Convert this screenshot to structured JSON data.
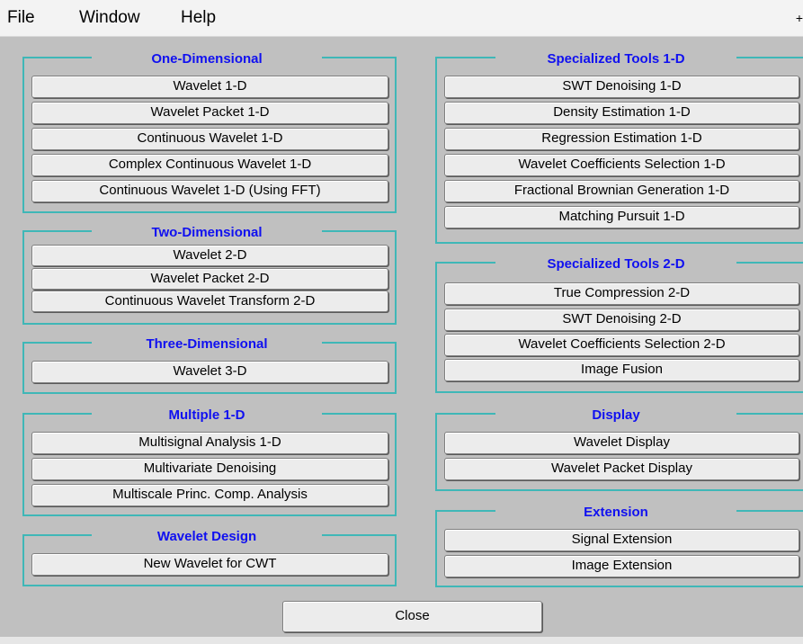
{
  "menu": {
    "file": "File",
    "window": "Window",
    "help": "Help",
    "corner": "+"
  },
  "groups": {
    "one_d": {
      "title": "One-Dimensional",
      "buttons": [
        "Wavelet 1-D",
        "Wavelet Packet 1-D",
        "Continuous Wavelet 1-D",
        "Complex Continuous Wavelet 1-D",
        "Continuous Wavelet 1-D (Using FFT)"
      ]
    },
    "two_d": {
      "title": "Two-Dimensional",
      "buttons": [
        "Wavelet 2-D",
        "Wavelet Packet 2-D",
        "Continuous Wavelet Transform 2-D"
      ]
    },
    "three_d": {
      "title": "Three-Dimensional",
      "buttons": [
        "Wavelet 3-D"
      ]
    },
    "multiple_1d": {
      "title": "Multiple 1-D",
      "buttons": [
        "Multisignal Analysis 1-D",
        "Multivariate Denoising",
        "Multiscale Princ. Comp. Analysis"
      ]
    },
    "wavelet_design": {
      "title": "Wavelet Design",
      "buttons": [
        "New Wavelet for CWT"
      ]
    },
    "spec_1d": {
      "title": "Specialized Tools 1-D",
      "buttons": [
        "SWT Denoising 1-D",
        "Density Estimation 1-D",
        "Regression Estimation 1-D",
        "Wavelet Coefficients Selection 1-D",
        "Fractional Brownian Generation 1-D",
        "Matching Pursuit 1-D"
      ]
    },
    "spec_2d": {
      "title": "Specialized Tools 2-D",
      "buttons": [
        "True Compression 2-D",
        "SWT Denoising 2-D",
        "Wavelet Coefficients Selection 2-D",
        "Image Fusion"
      ]
    },
    "display": {
      "title": "Display",
      "buttons": [
        "Wavelet Display",
        "Wavelet Packet Display"
      ]
    },
    "extension": {
      "title": "Extension",
      "buttons": [
        "Signal Extension",
        "Image Extension"
      ]
    }
  },
  "close_label": "Close",
  "colors": {
    "background": "#c0c0c0",
    "panel_border": "#3fb7b7",
    "group_title": "#1010f0",
    "button_face": "#ececec",
    "menubar": "#f3f3f3"
  }
}
